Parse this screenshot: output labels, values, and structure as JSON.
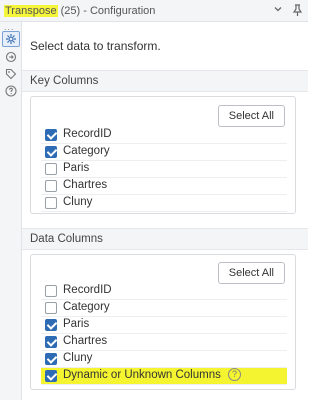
{
  "window": {
    "tool_name": "Transpose",
    "title_rest": " (25) - Configuration",
    "pin_icon": "pin-icon",
    "collapse_icon": "chevron-down-icon"
  },
  "sidebar": {
    "grip": "...",
    "icons": [
      "gear-icon",
      "connection-icon",
      "tag-icon",
      "help-icon"
    ]
  },
  "intro_text": "Select data to transform.",
  "key_columns": {
    "header": "Key Columns",
    "select_all_label": "Select All",
    "items": [
      {
        "label": "RecordID",
        "checked": true
      },
      {
        "label": "Category",
        "checked": true
      },
      {
        "label": "Paris",
        "checked": false
      },
      {
        "label": "Chartres",
        "checked": false
      },
      {
        "label": "Cluny",
        "checked": false
      }
    ]
  },
  "data_columns": {
    "header": "Data Columns",
    "select_all_label": "Select All",
    "items": [
      {
        "label": "RecordID",
        "checked": false
      },
      {
        "label": "Category",
        "checked": false
      },
      {
        "label": "Paris",
        "checked": true
      },
      {
        "label": "Chartres",
        "checked": true
      },
      {
        "label": "Cluny",
        "checked": true
      },
      {
        "label": "Dynamic or Unknown Columns",
        "checked": true
      }
    ],
    "help_glyph": "?"
  },
  "colors": {
    "accent": "#2d6bb4",
    "highlight": "#f4f530"
  }
}
